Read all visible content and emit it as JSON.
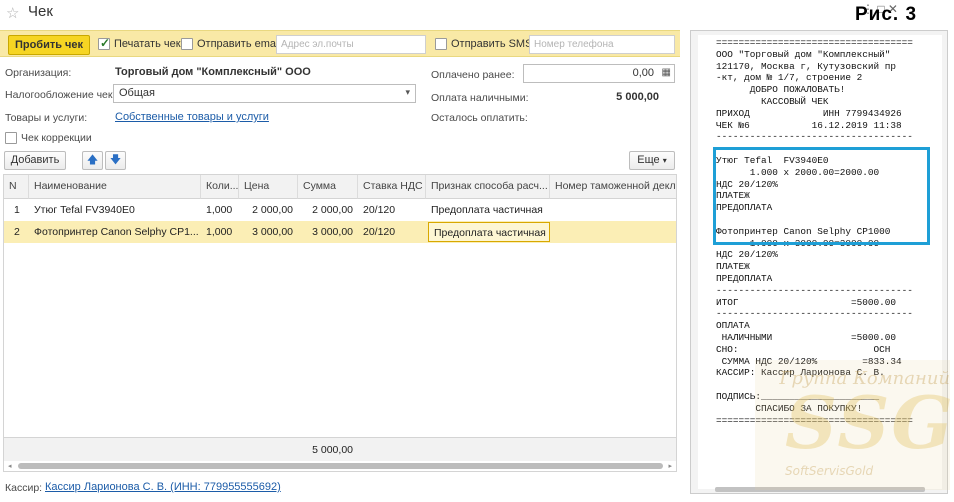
{
  "window": {
    "title": "Чек",
    "figure_label": "Рис. 3",
    "controls": "⋮  □  ✕"
  },
  "toolbar": {
    "punch_label": "Пробить чек",
    "print_check_label": "Печатать чек",
    "print_check_checked": true,
    "send_email_label": "Отправить email",
    "send_email_checked": false,
    "email_placeholder": "Адрес эл.почты",
    "send_sms_label": "Отправить SMS",
    "send_sms_checked": false,
    "phone_placeholder": "Номер телефона"
  },
  "form": {
    "org_label": "Организация:",
    "org_value": "Торговый дом \"Комплексный\" ООО",
    "tax_label": "Налогообложение чека:",
    "tax_value": "Общая",
    "goods_label": "Товары и услуги:",
    "goods_value": "Собственные товары и услуги",
    "correction_label": "Чек коррекции",
    "paid_before_label": "Оплачено ранее:",
    "paid_before_value": "0,00",
    "cash_label": "Оплата наличными:",
    "cash_value": "5 000,00",
    "remaining_label": "Осталось оплатить:"
  },
  "table_toolbar": {
    "add_label": "Добавить",
    "more_label": "Еще"
  },
  "table": {
    "columns": [
      "N",
      "Наименование",
      "Коли...",
      "Цена",
      "Сумма",
      "Ставка НДС",
      "Признак способа расч...",
      "Номер таможенной деклар..."
    ],
    "rows": [
      [
        "1",
        "Утюг Tefal  FV3940E0",
        "1,000",
        "2 000,00",
        "2 000,00",
        "20/120",
        "Предоплата частичная",
        ""
      ],
      [
        "2",
        "Фотопринтер Canon Selphy CP1...",
        "1,000",
        "3 000,00",
        "3 000,00",
        "20/120",
        "Предоплата частичная",
        ""
      ]
    ],
    "selected_row": 1,
    "footer_total": "5 000,00"
  },
  "cashier": {
    "label": "Кассир:",
    "value": "Кассир Ларионова С. В. (ИНН: 779955555692)"
  },
  "receipt": {
    "lines": [
      "===================================",
      "ООО \"Торговый дом \"Комплексный\"",
      "121170, Москва г, Кутузовский пр",
      "-кт, дом № 1/7, строение 2",
      "      ДОБРО ПОЖАЛОВАТЬ!",
      "        КАССОВЫЙ ЧЕК",
      "ПРИХОД             ИНН 7799434926",
      "ЧЕК №6           16.12.2019 11:38",
      "-----------------------------------",
      "",
      "Утюг Tefal  FV3940E0",
      "      1.000 x 2000.00=2000.00",
      "НДС 20/120%",
      "ПЛАТЕЖ",
      "ПРЕДОПЛАТА",
      "",
      "Фотопринтер Canon Selphy CP1000",
      "      1.000 x 3000.00=3000.00",
      "НДС 20/120%",
      "ПЛАТЕЖ",
      "ПРЕДОПЛАТА",
      "-----------------------------------",
      "ИТОГ                    =5000.00",
      "-----------------------------------",
      "ОПЛАТА",
      " НАЛИЧНЫМИ              =5000.00",
      "СНО:                        ОСН",
      " СУММА НДС 20/120%        =833.34",
      "КАССИР: Кассир Ларионова С. В.",
      "",
      "ПОДПИСЬ:_____________________",
      "       СПАСИБО ЗА ПОКУПКУ!",
      "==================================="
    ]
  },
  "watermark": {
    "top": "Группа Компаний",
    "big": "SSG",
    "bottom": "SoftServisGold"
  },
  "colors": {
    "toolbar_bg": "#f9e9a6",
    "primary_button": "#f6d523",
    "selected_row": "#fbeeb5",
    "highlight_frame": "#1e9fd6",
    "link": "#1c5ca8"
  }
}
